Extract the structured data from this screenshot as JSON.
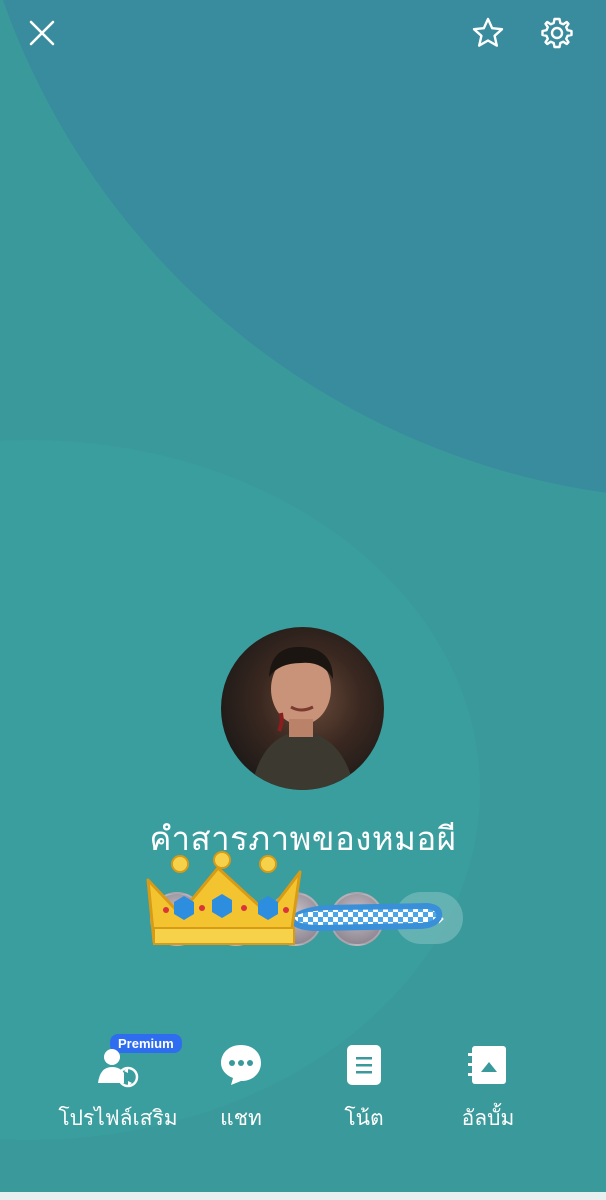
{
  "profile": {
    "name": "คำสารภาพของหมอผี"
  },
  "nav": {
    "extra_profile_label": "โปรไฟล์เสริม",
    "premium_badge": "Premium",
    "chat_label": "แชท",
    "note_label": "โน้ต",
    "album_label": "อัลบั้ม"
  },
  "icons": {
    "close": "close-icon",
    "favorite": "star-icon",
    "settings": "gear-icon",
    "more": "chevron-right-icon"
  },
  "colors": {
    "background": "#3a9a9b",
    "arc": "#388c9d",
    "premium": "#2f6df0"
  }
}
